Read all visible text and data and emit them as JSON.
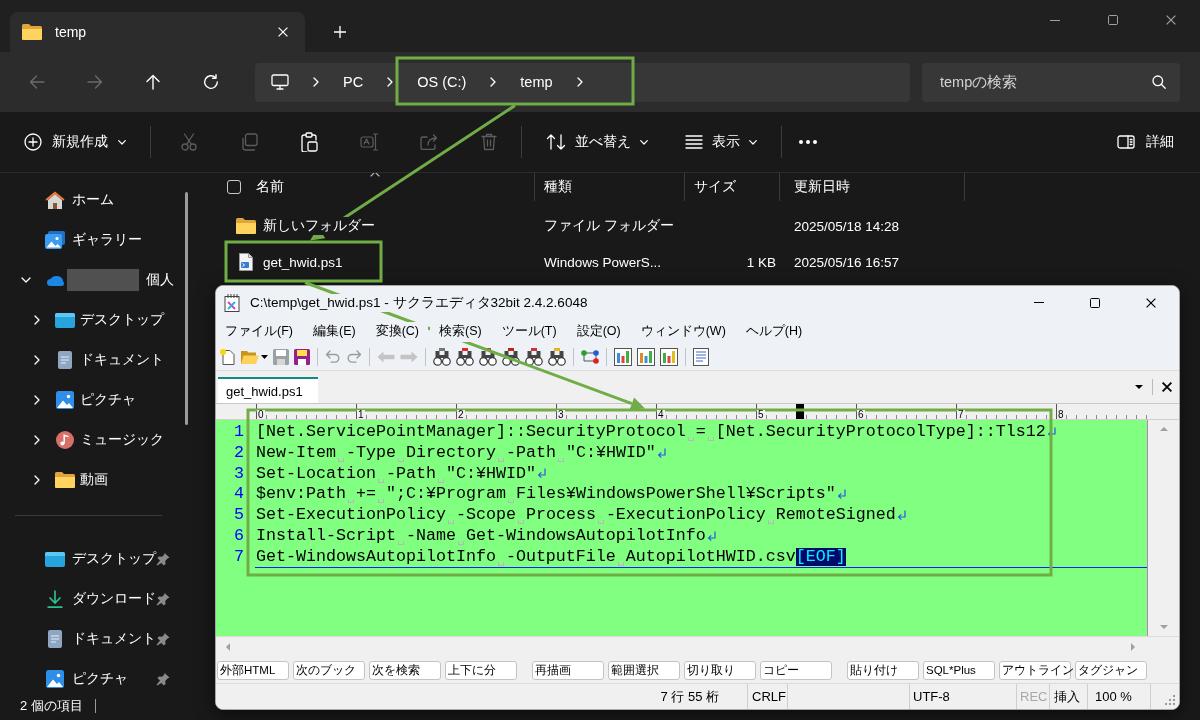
{
  "explorer": {
    "tabs": [
      {
        "label": "temp",
        "selected": true
      }
    ],
    "address_bar": {
      "path": [
        {
          "label": "PC",
          "highlighted": false
        },
        {
          "label": "OS (C:)",
          "highlighted": true
        },
        {
          "label": "temp",
          "highlighted": true
        }
      ]
    },
    "search": {
      "placeholder": "tempの検索"
    },
    "command_bar": {
      "new": "新規作成",
      "actions": [
        {
          "disabled": true
        },
        {
          "disabled": true
        },
        {
          "disabled": false
        },
        {
          "disabled": true
        },
        {
          "disabled": true
        },
        {
          "disabled": true
        }
      ],
      "sort": "並べ替え",
      "view": "表示",
      "details": "詳細"
    },
    "sidebar": {
      "items": [
        {
          "kind": "home",
          "label": "ホーム"
        },
        {
          "kind": "gallery",
          "label": "ギャラリー"
        },
        {
          "kind": "cloud",
          "label": "個人",
          "redacted": true,
          "expanded": true,
          "children": [
            {
              "kind": "desktop",
              "label": "デスクトップ",
              "expanded": false
            },
            {
              "kind": "documents",
              "label": "ドキュメント",
              "expanded": false
            },
            {
              "kind": "pictures",
              "label": "ピクチャ",
              "expanded": false
            },
            {
              "kind": "music",
              "label": "ミュージック",
              "expanded": false
            },
            {
              "kind": "videos",
              "label": "動画",
              "expanded": false
            }
          ]
        }
      ],
      "pinned": [
        {
          "kind": "desktop",
          "label": "デスクトップ",
          "pinned": true
        },
        {
          "kind": "downloads",
          "label": "ダウンロード",
          "pinned": true
        },
        {
          "kind": "documents",
          "label": "ドキュメント",
          "pinned": true
        },
        {
          "kind": "pictures",
          "label": "ピクチャ",
          "pinned": true
        }
      ]
    },
    "file_list": {
      "select_all": {
        "checked": false
      },
      "columns": [
        {
          "label": "名前",
          "sorted": true
        },
        {
          "label": "種類",
          "sorted": false
        },
        {
          "label": "サイズ",
          "sorted": false
        },
        {
          "label": "更新日時",
          "sorted": false
        }
      ],
      "rows": [
        {
          "kind": "folder",
          "name": "新しいフォルダー",
          "type": "ファイル フォルダー",
          "modified": "2025/05/18 14:28",
          "highlighted": false
        },
        {
          "kind": "script",
          "name": "get_hwid.ps1",
          "type": "Windows PowerS...",
          "size": "1 KB",
          "modified": "2025/05/16 16:57",
          "highlighted": true
        }
      ]
    },
    "status_bar": {
      "item_count": "2 個の項目"
    }
  },
  "editor": {
    "title": "C:\\temp\\get_hwid.ps1 - サクラエディタ32bit 2.4.2.6048",
    "menu": [
      "ファイル(F)",
      "編集(E)",
      "変換(C)",
      "検索(S)",
      "ツール(T)",
      "設定(O)",
      "ウィンドウ(W)",
      "ヘルプ(H)"
    ],
    "toolbar": [
      {
        "disabled": false
      },
      {
        "disabled": false
      },
      {
        "disabled": false
      },
      {
        "disabled": true
      },
      {
        "disabled": false
      },
      {
        "disabled": true
      },
      {
        "disabled": true
      },
      {
        "disabled": true
      },
      {
        "disabled": true
      },
      {
        "disabled": false
      },
      {
        "disabled": false
      },
      {
        "disabled": false
      },
      {
        "disabled": false
      },
      {
        "disabled": false
      },
      {
        "disabled": false
      },
      {
        "disabled": false
      },
      {
        "disabled": false
      },
      {
        "disabled": false
      },
      {
        "disabled": false
      },
      {
        "disabled": false
      }
    ],
    "tabs": [
      {
        "label": "get_hwid.ps1",
        "selected": true
      }
    ],
    "ruler": {
      "labels": [
        "0",
        "1",
        "2",
        "3",
        "4",
        "5",
        "6",
        "7",
        "8"
      ]
    },
    "code": {
      "highlighted": true,
      "lines": [
        {
          "number": "1",
          "text": "[Net.ServicePointManager]::SecurityProtocol = [Net.SecurityProtocolType]::Tls12"
        },
        {
          "number": "2",
          "text": "New-Item -Type Directory -Path \"C:¥HWID\""
        },
        {
          "number": "3",
          "text": "Set-Location -Path \"C:¥HWID\""
        },
        {
          "number": "4",
          "text": "$env:Path += \";C:¥Program Files¥WindowsPowerShell¥Scripts\""
        },
        {
          "number": "5",
          "text": "Set-ExecutionPolicy -Scope Process -ExecutionPolicy RemoteSigned"
        },
        {
          "number": "6",
          "text": "Install-Script -Name Get-WindowsAutopilotInfo"
        },
        {
          "number": "7",
          "text": "Get-WindowsAutopilotInfo -OutputFile AutopilotHWID.csv"
        }
      ],
      "eof": "[EOF]"
    },
    "function_keys": [
      "外部HTML",
      "次のブック",
      "次を検索",
      "上下に分",
      "再描画",
      "範囲選択",
      "切り取り",
      "コピー",
      "貼り付け",
      "SQL*Plus",
      "アウトライン",
      "タグジャン"
    ],
    "status_bar": {
      "position": "7 行 55 桁",
      "line_ending": "CRLF",
      "encoding": "UTF-8",
      "rec": {
        "label": "REC",
        "disabled": true
      },
      "mode": "挿入",
      "zoom": "100 %"
    }
  }
}
